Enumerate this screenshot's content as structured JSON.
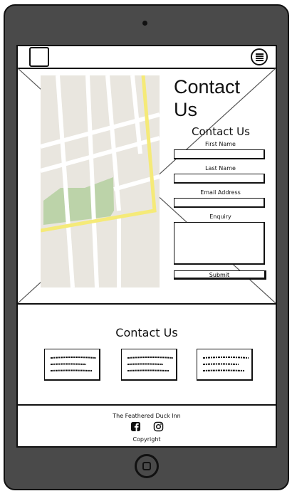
{
  "page": {
    "heading": "Contact\nUs",
    "form": {
      "title": "Contact Us",
      "fields": [
        {
          "label": "First Name"
        },
        {
          "label": "Last Name"
        },
        {
          "label": "Email Address"
        }
      ],
      "enquiry_label": "Enquiry",
      "submit_label": "Submit"
    }
  },
  "contact_section": {
    "title": "Contact Us",
    "cards": [
      {
        "icon": "text-placeholder-icon"
      },
      {
        "icon": "text-placeholder-icon"
      },
      {
        "icon": "text-placeholder-icon"
      }
    ]
  },
  "footer": {
    "business_name": "The Feathered Duck Inn",
    "social_icons": [
      "facebook-icon",
      "instagram-icon"
    ],
    "copyright": "Copyright"
  },
  "colors": {
    "map_background": "#e9e6df",
    "map_park": "#bcd3a9",
    "map_highway": "#f5ea78",
    "wireframe_ink": "#111111",
    "device_body": "#4a4a4a"
  }
}
